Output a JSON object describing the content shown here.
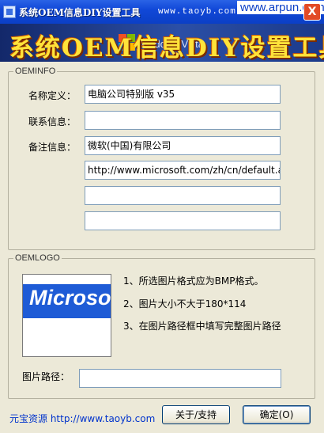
{
  "window": {
    "title": "系统OEM信息DIY设置工具",
    "title_url": "www.taoyb.com",
    "watermark": "www.arpun.com",
    "close_label": "X"
  },
  "banner": {
    "text": "系统OEM信息DIY设置工具",
    "overlay_text": "Windows Vista"
  },
  "oeminfo": {
    "legend": "OEMINFO",
    "name_label": "名称定义：",
    "name_value": "电脑公司特别版 v35",
    "contact_label": "联系信息：",
    "contact_value": "",
    "note_label": "备注信息：",
    "note_lines": [
      "微软(中国)有限公司",
      "http://www.microsoft.com/zh/cn/default.asp",
      "",
      ""
    ]
  },
  "oemlogo": {
    "legend": "OEMLOGO",
    "preview_text": "Microsoft",
    "preview_colors": {
      "band": "#1e5bd6",
      "text": "#ffffff"
    },
    "instructions": [
      "1、所选图片格式应为BMP格式。",
      "2、图片大小不大于180*114",
      "3、在图片路径框中填写完整图片路径"
    ],
    "path_label": "图片路径：",
    "path_value": ""
  },
  "footer": {
    "link_text": "元宝资源 http://www.taoyb.com",
    "about_button": "关于/支持",
    "ok_button": "确定(O)"
  }
}
